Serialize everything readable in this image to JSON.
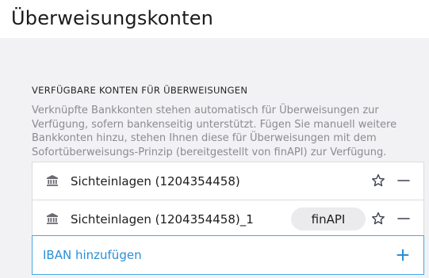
{
  "header": {
    "title": "Überweisungskonten"
  },
  "section": {
    "heading": "VERFÜGBARE KONTEN FÜR ÜBERWEISUNGEN",
    "description": "Verknüpfte Bankkonten stehen automatisch für Überweisungen zur Verfügung, sofern bankenseitig unterstützt. Fügen Sie manuell weitere Bankkonten hinzu, stehen Ihnen diese für Überweisungen mit dem Sofortüberweisungs-Prinzip (bereitgestellt von finAPI) zur Verfügung."
  },
  "accounts": [
    {
      "name": "Sichteinlagen (1204354458)",
      "icon": "bank-icon",
      "badge": ""
    },
    {
      "name": "Sichteinlagen (1204354458)_1",
      "icon": "bank-icon",
      "badge": "finAPI"
    }
  ],
  "add_iban": {
    "label": "IBAN hinzufügen",
    "icon": "plus-icon"
  },
  "colors": {
    "accent": "#2a8fd6",
    "border_focus": "#4aa6e6",
    "background": "#f2f2f4",
    "muted_text": "#8b8b92"
  }
}
